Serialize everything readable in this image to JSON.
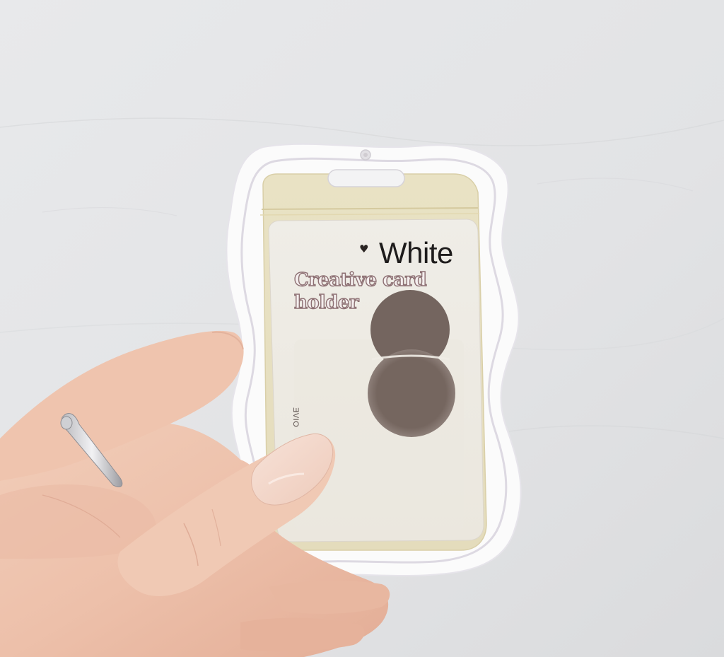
{
  "photo": {
    "card": {
      "heart_icon": "heart-icon",
      "brand": "White",
      "headline_line1": "Creative card",
      "headline_line2": "holder",
      "side_text": "ƎVIO"
    },
    "colors": {
      "wall": "#e3e4e6",
      "frame": "#fbfbfb",
      "sleeve": "#e9e0bf",
      "card": "#efece5",
      "circle": "#7a6c6a",
      "skin": "#f0c8b4"
    }
  }
}
